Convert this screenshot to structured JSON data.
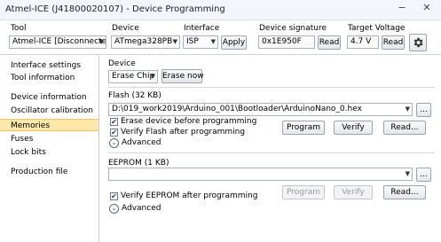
{
  "window": {
    "title": "Atmel-ICE (J41800020107) - Device Programming",
    "minimize_icon": "−",
    "close_icon": "✕"
  },
  "toolbar": {
    "tool_label": "Tool",
    "tool_value": "Atmel-ICE [Disconnected]",
    "device_label": "Device",
    "device_value": "ATmega328PB",
    "interface_label": "Interface",
    "interface_value": "ISP",
    "apply_label": "Apply",
    "signature_label": "Device signature",
    "signature_value": "0x1E950F",
    "signature_read": "Read",
    "voltage_label": "Target Voltage",
    "voltage_value": "4.7 V",
    "voltage_read": "Read",
    "settings_icon": "gear-icon"
  },
  "sidebar": {
    "items": [
      {
        "label": "Interface settings"
      },
      {
        "label": "Tool information"
      },
      {
        "label": "Device information"
      },
      {
        "label": "Oscillator calibration"
      },
      {
        "label": "Memories"
      },
      {
        "label": "Fuses"
      },
      {
        "label": "Lock bits"
      },
      {
        "label": "Production file"
      }
    ],
    "selected": "Memories"
  },
  "device_section": {
    "title": "Device",
    "erase_chip": "Erase Chip",
    "erase_now": "Erase now"
  },
  "flash": {
    "title": "Flash (32 KB)",
    "path": "D:\\019_work2019\\Arduino_001\\Bootloader\\ArduinoNano_0.hex",
    "browse": "...",
    "erase_before": "Erase device before programming",
    "verify_after": "Verify Flash after programming",
    "program": "Program",
    "verify": "Verify",
    "read": "Read...",
    "advanced": "Advanced"
  },
  "eeprom": {
    "title": "EEPROM (1 KB)",
    "path": "",
    "browse": "...",
    "verify_after": "Verify EEPROM after programming",
    "program": "Program",
    "verify": "Verify",
    "read": "Read...",
    "advanced": "Advanced"
  }
}
